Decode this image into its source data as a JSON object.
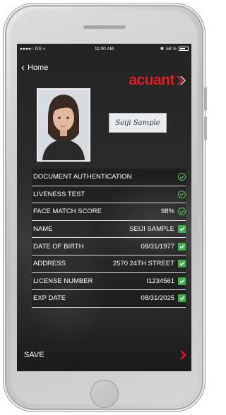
{
  "status_bar": {
    "carrier": "●●●●○ GS ",
    "wifi_icon": "wifi-icon",
    "time": "11:00 AM",
    "bluetooth_icon": "bluetooth-icon",
    "battery_text": "58 %",
    "battery_level": 0.58
  },
  "nav": {
    "back_label": "Home"
  },
  "brand": {
    "logo_text": "acuant",
    "color": "#e31b23"
  },
  "signature": {
    "text": "Seiji Sample"
  },
  "rows": [
    {
      "label": "DOCUMENT AUTHENTICATION",
      "value": "",
      "check": "circle"
    },
    {
      "label": "LIVENESS TEST",
      "value": "",
      "check": "circle"
    },
    {
      "label": "FACE MATCH SCORE",
      "value": "98%",
      "check": "circle"
    },
    {
      "label": "NAME",
      "value": "SEIJI SAMPLE",
      "check": "box"
    },
    {
      "label": "DATE OF BIRTH",
      "value": "08/31/1977",
      "check": "box"
    },
    {
      "label": "ADDRESS",
      "value": "2570 24TH STREET",
      "check": "box"
    },
    {
      "label": "LICENSE NUMBER",
      "value": "I1234561",
      "check": "box"
    },
    {
      "label": "EXP DATE",
      "value": "08/31/2025",
      "check": "box"
    }
  ],
  "footer": {
    "save_label": "SAVE"
  },
  "colors": {
    "check_green": "#3cb049",
    "accent_red": "#e31b23"
  }
}
